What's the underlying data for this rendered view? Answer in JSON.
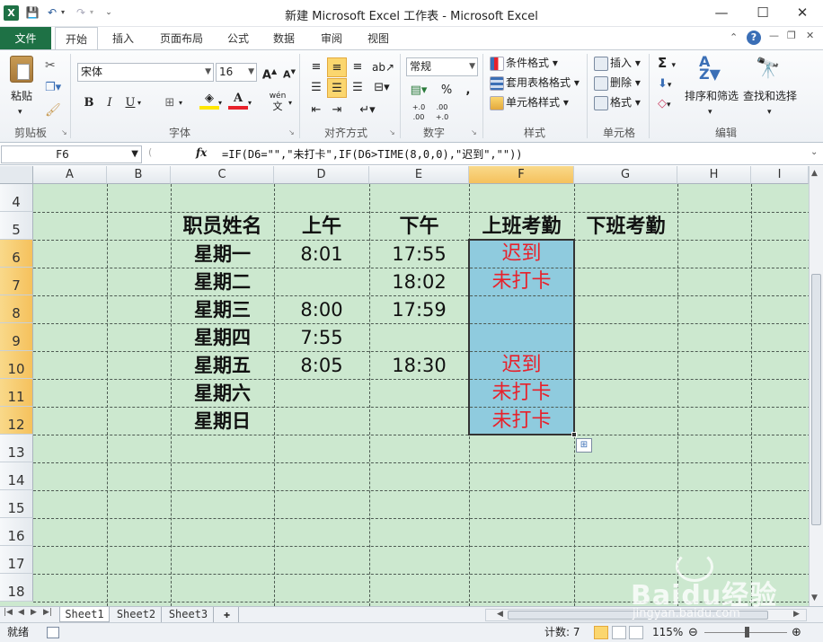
{
  "window": {
    "title": "新建 Microsoft Excel 工作表 - Microsoft Excel",
    "minimize": "—",
    "maximize": "☐",
    "close": "✕"
  },
  "tabs": [
    "文件",
    "开始",
    "插入",
    "页面布局",
    "公式",
    "数据",
    "审阅",
    "视图"
  ],
  "ribbon": {
    "clipboard": {
      "label": "剪贴板",
      "paste": "粘贴"
    },
    "font": {
      "label": "字体",
      "name": "宋体",
      "size": "16",
      "bold": "B",
      "italic": "I",
      "underline": "U",
      "grow": "A",
      "shrink": "A",
      "phonetic": "wén",
      "color_letter": "A"
    },
    "alignment": {
      "label": "对齐方式"
    },
    "number": {
      "label": "数字",
      "format": "常规",
      "percent": "%",
      "comma": ",",
      "inc": "+.0 .00",
      "dec": ".00 +.0"
    },
    "styles": {
      "label": "样式",
      "conditional": "条件格式",
      "table": "套用表格格式",
      "cell_styles": "单元格样式"
    },
    "cells": {
      "label": "单元格",
      "insert": "插入",
      "delete": "删除",
      "format": "格式"
    },
    "editing": {
      "label": "编辑",
      "sum": "Σ",
      "sort": "排序和筛选",
      "find": "查找和选择"
    }
  },
  "formula_bar": {
    "name_box": "F6",
    "fx": "fx",
    "formula": "=IF(D6=\"\",\"未打卡\",IF(D6>TIME(8,0,0),\"迟到\",\"\"))"
  },
  "grid": {
    "columns": [
      "A",
      "B",
      "C",
      "D",
      "E",
      "F",
      "G",
      "H",
      "I"
    ],
    "rows": [
      "4",
      "5",
      "6",
      "7",
      "8",
      "9",
      "10",
      "11",
      "12",
      "13",
      "14",
      "15",
      "16",
      "17",
      "18"
    ],
    "headers": {
      "c5": "职员姓名",
      "d5": "上午",
      "e5": "下午",
      "f5": "上班考勤",
      "g5": "下班考勤"
    },
    "days": [
      "星期一",
      "星期二",
      "星期三",
      "星期四",
      "星期五",
      "星期六",
      "星期日"
    ],
    "morning": [
      "8:01",
      "",
      "8:00",
      "7:55",
      "8:05",
      "",
      ""
    ],
    "afternoon": [
      "17:55",
      "18:02",
      "17:59",
      "",
      "18:30",
      "",
      ""
    ],
    "attendance": [
      "迟到",
      "未打卡",
      "",
      "",
      "迟到",
      "未打卡",
      "未打卡"
    ],
    "selection_bg": "#8fcbde",
    "red_text": "#e8212b",
    "sheet_bg": "#cce8cf"
  },
  "sheet_tabs": [
    "Sheet1",
    "Sheet2",
    "Sheet3"
  ],
  "status": {
    "ready": "就绪",
    "count": "计数: 7",
    "zoom": "115%",
    "watermark": "Baidu经验",
    "watermark_url": "jingyan.baidu.com"
  }
}
